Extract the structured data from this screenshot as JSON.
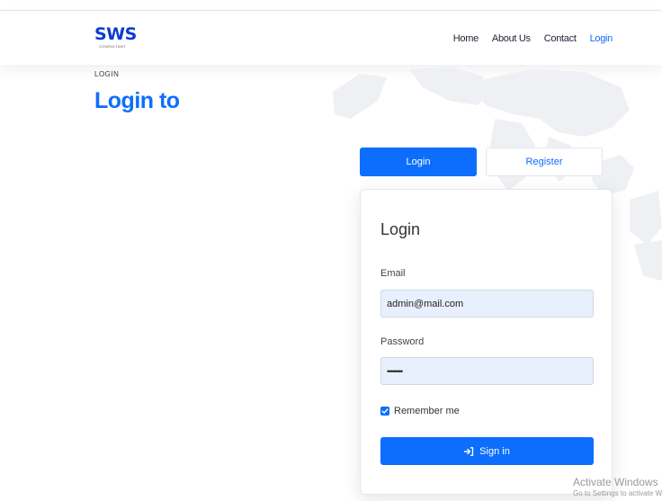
{
  "brand": {
    "name": "SWS",
    "tagline": "CONSULTANT"
  },
  "nav": {
    "items": [
      "Home",
      "About Us",
      "Contact",
      "Login"
    ],
    "active": "Login"
  },
  "page": {
    "breadcrumb": "LOGIN",
    "title": "Login to"
  },
  "tabs": {
    "login": "Login",
    "register": "Register"
  },
  "form": {
    "title": "Login",
    "email_label": "Email",
    "email_value": "admin@mail.com",
    "password_label": "Password",
    "password_value": "••••••••",
    "remember_label": "Remember me",
    "remember_checked": true,
    "submit_label": "Sign in"
  },
  "watermark": {
    "title": "Activate Windows",
    "subtitle": "Go to Settings to activate Windows."
  },
  "colors": {
    "primary": "#0d6efd",
    "brand": "#0d3ad6",
    "input_bg": "#e8f0fe"
  }
}
